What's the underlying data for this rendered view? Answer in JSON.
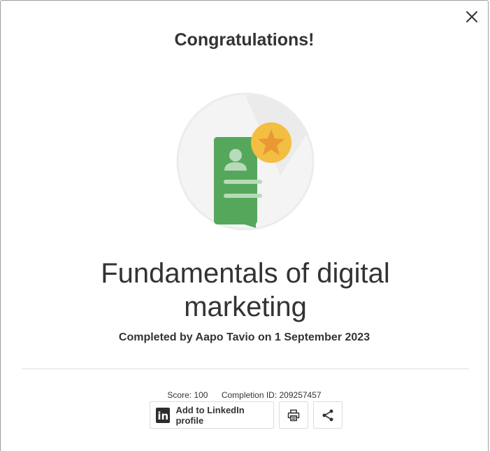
{
  "dialog": {
    "heading": "Congratulations!",
    "course_title": "Fundamentals of digital marketing",
    "completed_by": "Completed by Aapo Tavio on 1 September 2023",
    "score": "Score: 100",
    "completion_id": "Completion ID: 209257457",
    "close_icon": "close-icon"
  },
  "actions": {
    "linkedin_label": "Add to LinkedIn profile",
    "linkedin_icon_text": "in",
    "print_icon": "print-icon",
    "share_icon": "share-icon"
  },
  "colors": {
    "badge_green": "#55a85b",
    "star_yellow": "#f3be41",
    "star_orange": "#e99834",
    "text": "#333333"
  }
}
